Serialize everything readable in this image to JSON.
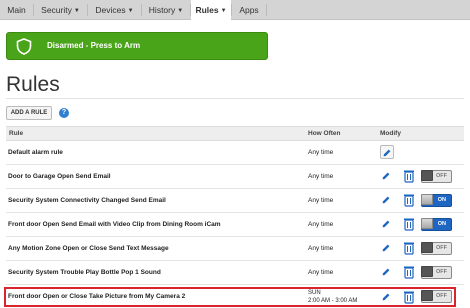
{
  "nav": {
    "tabs": [
      {
        "label": "Main",
        "dropdown": false,
        "active": false
      },
      {
        "label": "Security",
        "dropdown": true,
        "active": false
      },
      {
        "label": "Devices",
        "dropdown": true,
        "active": false
      },
      {
        "label": "History",
        "dropdown": true,
        "active": false
      },
      {
        "label": "Rules",
        "dropdown": true,
        "active": true
      },
      {
        "label": "Apps",
        "dropdown": false,
        "active": false
      }
    ]
  },
  "arm_button": {
    "label": "Disarmed - Press to Arm",
    "icon": "shield-icon",
    "color": "#4aa419"
  },
  "page_title": "Rules",
  "add_rule_label": "ADD A RULE",
  "help_icon": "?",
  "table": {
    "headers": {
      "rule": "Rule",
      "how_often": "How Often",
      "modify": "Modify"
    },
    "rows": [
      {
        "name": "Default alarm rule",
        "how_often": "Any time",
        "how_often_line2": "",
        "deletable": false,
        "toggle": null
      },
      {
        "name": "Door to Garage Open Send Email",
        "how_often": "Any time",
        "how_often_line2": "",
        "deletable": true,
        "toggle": "OFF"
      },
      {
        "name": "Security System Connectivity Changed Send Email",
        "how_often": "Any time",
        "how_often_line2": "",
        "deletable": true,
        "toggle": "ON"
      },
      {
        "name": "Front door Open Send Email with Video Clip from Dining Room iCam",
        "how_often": "Any time",
        "how_often_line2": "",
        "deletable": true,
        "toggle": "ON"
      },
      {
        "name": "Any Motion Zone Open or Close Send Text Message",
        "how_often": "Any time",
        "how_often_line2": "",
        "deletable": true,
        "toggle": "OFF"
      },
      {
        "name": "Security System Trouble Play Bottle Pop 1 Sound",
        "how_often": "Any time",
        "how_often_line2": "",
        "deletable": true,
        "toggle": "OFF"
      },
      {
        "name": "Front door Open or Close Take Picture from My Camera 2",
        "how_often": "SUN",
        "how_often_line2": "2:00 AM - 3:00 AM",
        "deletable": true,
        "toggle": "OFF",
        "highlighted": true
      }
    ]
  },
  "colors": {
    "accent_blue": "#1f66c2",
    "highlight_red": "#d9232d"
  }
}
